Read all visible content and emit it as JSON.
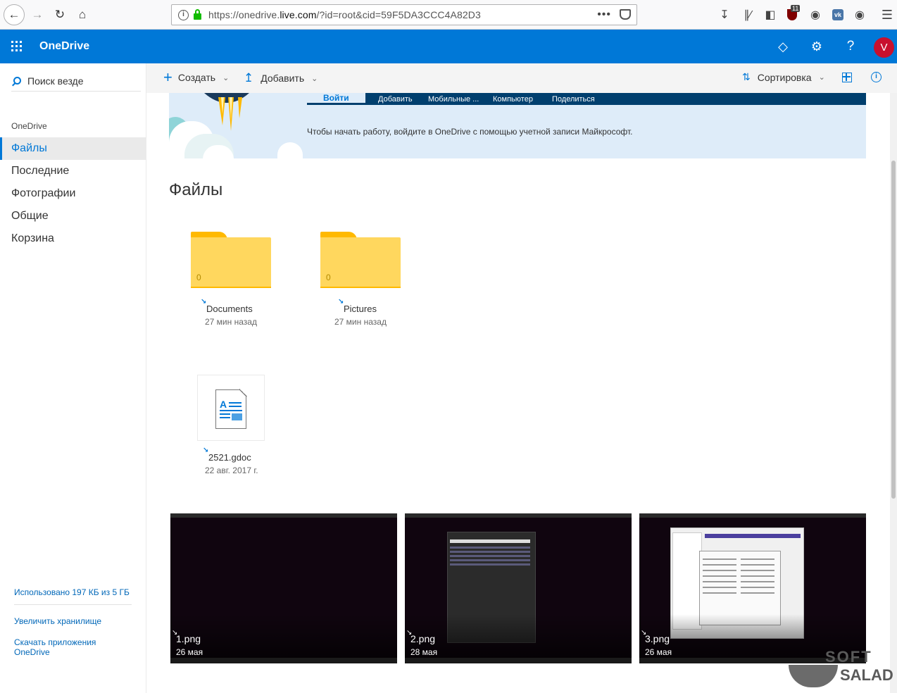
{
  "browser": {
    "url_prefix": "https://onedrive.",
    "url_domain": "live.com",
    "url_suffix": "/?id=root&cid=59F5DA3CCC4A82D3",
    "url_dots": "•••",
    "badge_count": "11"
  },
  "header": {
    "app_name": "OneDrive",
    "avatar_letter": "V",
    "help_label": "?"
  },
  "sidebar": {
    "search_placeholder": "Поиск везде",
    "section_label": "OneDrive",
    "items": [
      {
        "label": "Файлы"
      },
      {
        "label": "Последние"
      },
      {
        "label": "Фотографии"
      },
      {
        "label": "Общие"
      },
      {
        "label": "Корзина"
      }
    ],
    "storage_text": "Использовано 197 КБ из 5 ГБ",
    "upgrade_link": "Увеличить хранилище",
    "apps_link_line1": "Скачать приложения",
    "apps_link_line2": "OneDrive"
  },
  "commandbar": {
    "create": "Создать",
    "add": "Добавить",
    "sort": "Сортировка"
  },
  "banner": {
    "tabs": [
      "Войти",
      "Добавить",
      "Мобильные ...",
      "Компьютер",
      "Поделиться"
    ],
    "message": "Чтобы начать работу, войдите в OneDrive с помощью учетной записи Майкрософт."
  },
  "main": {
    "title": "Файлы",
    "folders": [
      {
        "name": "Documents",
        "date": "27 мин назад",
        "count": "0"
      },
      {
        "name": "Pictures",
        "date": "27 мин назад",
        "count": "0"
      }
    ],
    "files": [
      {
        "name": "2521.gdoc",
        "date": "22 авг. 2017 г."
      }
    ],
    "images": [
      {
        "name": "1.png",
        "date": "26 мая"
      },
      {
        "name": "2.png",
        "date": "28 мая"
      },
      {
        "name": "3.png",
        "date": "26 мая"
      }
    ]
  },
  "watermark": {
    "line1": "SOFT",
    "line2": "SALAD"
  }
}
